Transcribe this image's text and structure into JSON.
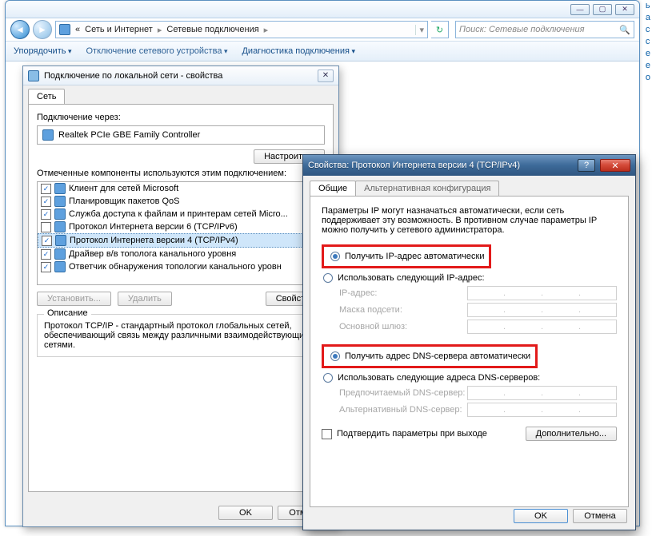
{
  "explorer": {
    "breadcrumb": {
      "seg1": "Сеть и Интернет",
      "seg2": "Сетевые подключения"
    },
    "search_placeholder": "Поиск: Сетевые подключения",
    "cmds": {
      "organize": "Упорядочить",
      "disable": "Отключение сетевого устройства",
      "diagnose": "Диагностика подключения"
    },
    "winbtns": {
      "min": "—",
      "max": "▢",
      "close": "✕"
    }
  },
  "rightbits": "ь\nа\nc\nc\nе\nе\nо",
  "dlg1": {
    "title": "Подключение по локальной сети - свойства",
    "tab": "Сеть",
    "connect_via_label": "Подключение через:",
    "adapter": "Realtek PCIe GBE Family Controller",
    "configure": "Настроить...",
    "components_label": "Отмеченные компоненты используются этим подключением:",
    "items": [
      {
        "checked": true,
        "label": "Клиент для сетей Microsoft"
      },
      {
        "checked": true,
        "label": "Планировщик пакетов QoS"
      },
      {
        "checked": true,
        "label": "Служба доступа к файлам и принтерам сетей Micro..."
      },
      {
        "checked": false,
        "label": "Протокол Интернета версии 6 (TCP/IPv6)"
      },
      {
        "checked": true,
        "label": "Протокол Интернета версии 4 (TCP/IPv4)",
        "selected": true
      },
      {
        "checked": true,
        "label": "Драйвер в/в тополога канального уровня"
      },
      {
        "checked": true,
        "label": "Ответчик обнаружения топологии канального уровн"
      }
    ],
    "btn_install": "Установить...",
    "btn_remove": "Удалить",
    "btn_props": "Свойства",
    "desc_label": "Описание",
    "desc_text": "Протокол TCP/IP - стандартный протокол глобальных сетей, обеспечивающий связь между различными взаимодействующими сетями.",
    "ok": "OK",
    "cancel": "Отмена"
  },
  "dlg2": {
    "title": "Свойства: Протокол Интернета версии 4 (TCP/IPv4)",
    "tab_general": "Общие",
    "tab_alt": "Альтернативная конфигурация",
    "intro": "Параметры IP могут назначаться автоматически, если сеть поддерживает эту возможность. В противном случае параметры IP можно получить у сетевого администратора.",
    "ip_auto": "Получить IP-адрес автоматически",
    "ip_manual": "Использовать следующий IP-адрес:",
    "f_ip": "IP-адрес:",
    "f_mask": "Маска подсети:",
    "f_gw": "Основной шлюз:",
    "dns_auto": "Получить адрес DNS-сервера автоматически",
    "dns_manual": "Использовать следующие адреса DNS-серверов:",
    "f_dns1": "Предпочитаемый DNS-сервер:",
    "f_dns2": "Альтернативный DNS-сервер:",
    "confirm_exit": "Подтвердить параметры при выходе",
    "advanced": "Дополнительно...",
    "ok": "OK",
    "cancel": "Отмена"
  }
}
